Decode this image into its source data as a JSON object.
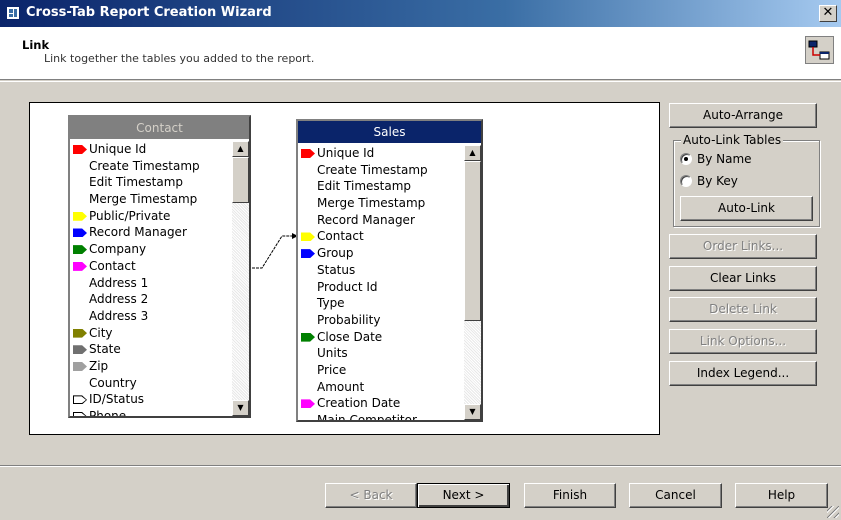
{
  "window": {
    "title": "Cross-Tab Report Creation Wizard",
    "close_label": "✕"
  },
  "header": {
    "title": "Link",
    "subtitle": "Link together the tables you added to the report."
  },
  "contact_table": {
    "title": "Contact",
    "rows": [
      {
        "label": "Unique Id",
        "tag": "#ff0000"
      },
      {
        "label": "Create Timestamp",
        "tag": ""
      },
      {
        "label": "Edit Timestamp",
        "tag": ""
      },
      {
        "label": "Merge Timestamp",
        "tag": ""
      },
      {
        "label": "Public/Private",
        "tag": "#ffff00"
      },
      {
        "label": "Record Manager",
        "tag": "#0000ff"
      },
      {
        "label": "Company",
        "tag": "#008000"
      },
      {
        "label": "Contact",
        "tag": "#ff00ff"
      },
      {
        "label": "Address 1",
        "tag": ""
      },
      {
        "label": "Address 2",
        "tag": ""
      },
      {
        "label": "Address 3",
        "tag": ""
      },
      {
        "label": "City",
        "tag": "#808000"
      },
      {
        "label": "State",
        "tag": "#707070"
      },
      {
        "label": "Zip",
        "tag": "#a0a0a0"
      },
      {
        "label": "Country",
        "tag": ""
      },
      {
        "label": "ID/Status",
        "tag": "outline"
      },
      {
        "label": "Phone",
        "tag": "outline"
      }
    ]
  },
  "sales_table": {
    "title": "Sales",
    "rows": [
      {
        "label": "Unique Id",
        "tag": "#ff0000"
      },
      {
        "label": "Create Timestamp",
        "tag": ""
      },
      {
        "label": "Edit Timestamp",
        "tag": ""
      },
      {
        "label": "Merge Timestamp",
        "tag": ""
      },
      {
        "label": "Record Manager",
        "tag": ""
      },
      {
        "label": "Contact",
        "tag": "#ffff00"
      },
      {
        "label": "Group",
        "tag": "#0000ff"
      },
      {
        "label": "Status",
        "tag": ""
      },
      {
        "label": "Product Id",
        "tag": ""
      },
      {
        "label": "Type",
        "tag": ""
      },
      {
        "label": "Probability",
        "tag": ""
      },
      {
        "label": "Close Date",
        "tag": "#008000"
      },
      {
        "label": "Units",
        "tag": ""
      },
      {
        "label": "Price",
        "tag": ""
      },
      {
        "label": "Amount",
        "tag": ""
      },
      {
        "label": "Creation Date",
        "tag": "#ff00ff"
      },
      {
        "label": "Main Competitor",
        "tag": ""
      }
    ]
  },
  "scroll": {
    "up": "▲",
    "down": "▼"
  },
  "right_panel": {
    "auto_arrange": "Auto-Arrange",
    "auto_link_group": "Auto-Link Tables",
    "by_name": "By Name",
    "by_key": "By Key",
    "auto_link": "Auto-Link",
    "order_links": "Order Links...",
    "clear_links": "Clear Links",
    "delete_link": "Delete Link",
    "link_options": "Link Options...",
    "index_legend": "Index Legend..."
  },
  "footer": {
    "back": "< Back",
    "next": "Next >",
    "finish": "Finish",
    "cancel": "Cancel",
    "help": "Help"
  }
}
